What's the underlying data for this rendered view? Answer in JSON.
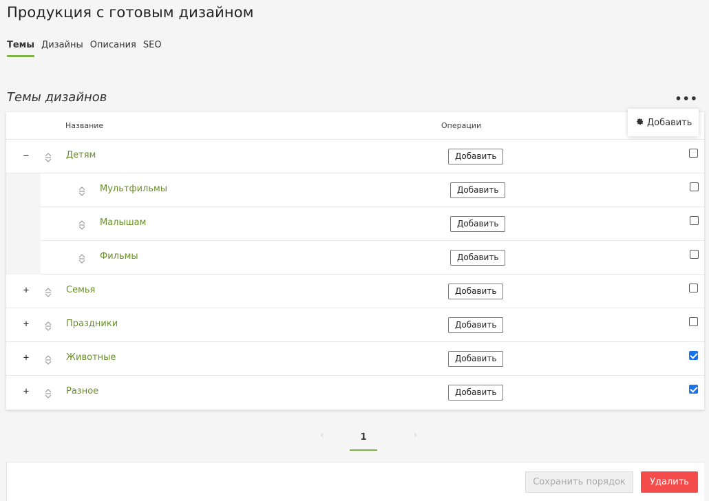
{
  "page": {
    "title": "Продукция с готовым дизайном"
  },
  "tabs": [
    {
      "label": "Темы",
      "active": true
    },
    {
      "label": "Дизайны",
      "active": false
    },
    {
      "label": "Описания",
      "active": false
    },
    {
      "label": "SEO",
      "active": false
    }
  ],
  "section": {
    "title": "Темы дизайнов",
    "more_label": "•••"
  },
  "dropdown": {
    "icon": "gear-icon",
    "label": "Добавить"
  },
  "table": {
    "columns": {
      "name": "Название",
      "operations": "Операции"
    },
    "rows": [
      {
        "name": "Детям",
        "level": 0,
        "toggle": "−",
        "add_label": "Добавить",
        "checked": false
      },
      {
        "name": "Мультфильмы",
        "level": 1,
        "toggle": "",
        "add_label": "Добавить",
        "checked": false
      },
      {
        "name": "Малышам",
        "level": 1,
        "toggle": "",
        "add_label": "Добавить",
        "checked": false
      },
      {
        "name": "Фильмы",
        "level": 1,
        "toggle": "",
        "add_label": "Добавить",
        "checked": false
      },
      {
        "name": "Семья",
        "level": 0,
        "toggle": "+",
        "add_label": "Добавить",
        "checked": false
      },
      {
        "name": "Праздники",
        "level": 0,
        "toggle": "+",
        "add_label": "Добавить",
        "checked": false
      },
      {
        "name": "Животные",
        "level": 0,
        "toggle": "+",
        "add_label": "Добавить",
        "checked": true
      },
      {
        "name": "Разное",
        "level": 0,
        "toggle": "+",
        "add_label": "Добавить",
        "checked": true
      }
    ]
  },
  "pagination": {
    "prev": "‹",
    "current": "1",
    "next": "›"
  },
  "footer": {
    "save_label": "Сохранить порядок",
    "delete_label": "Удалить"
  },
  "colors": {
    "accent": "#7cb342",
    "link": "#6a8f2a",
    "danger": "#f44b4b",
    "checkbox": "#1a73e8"
  }
}
